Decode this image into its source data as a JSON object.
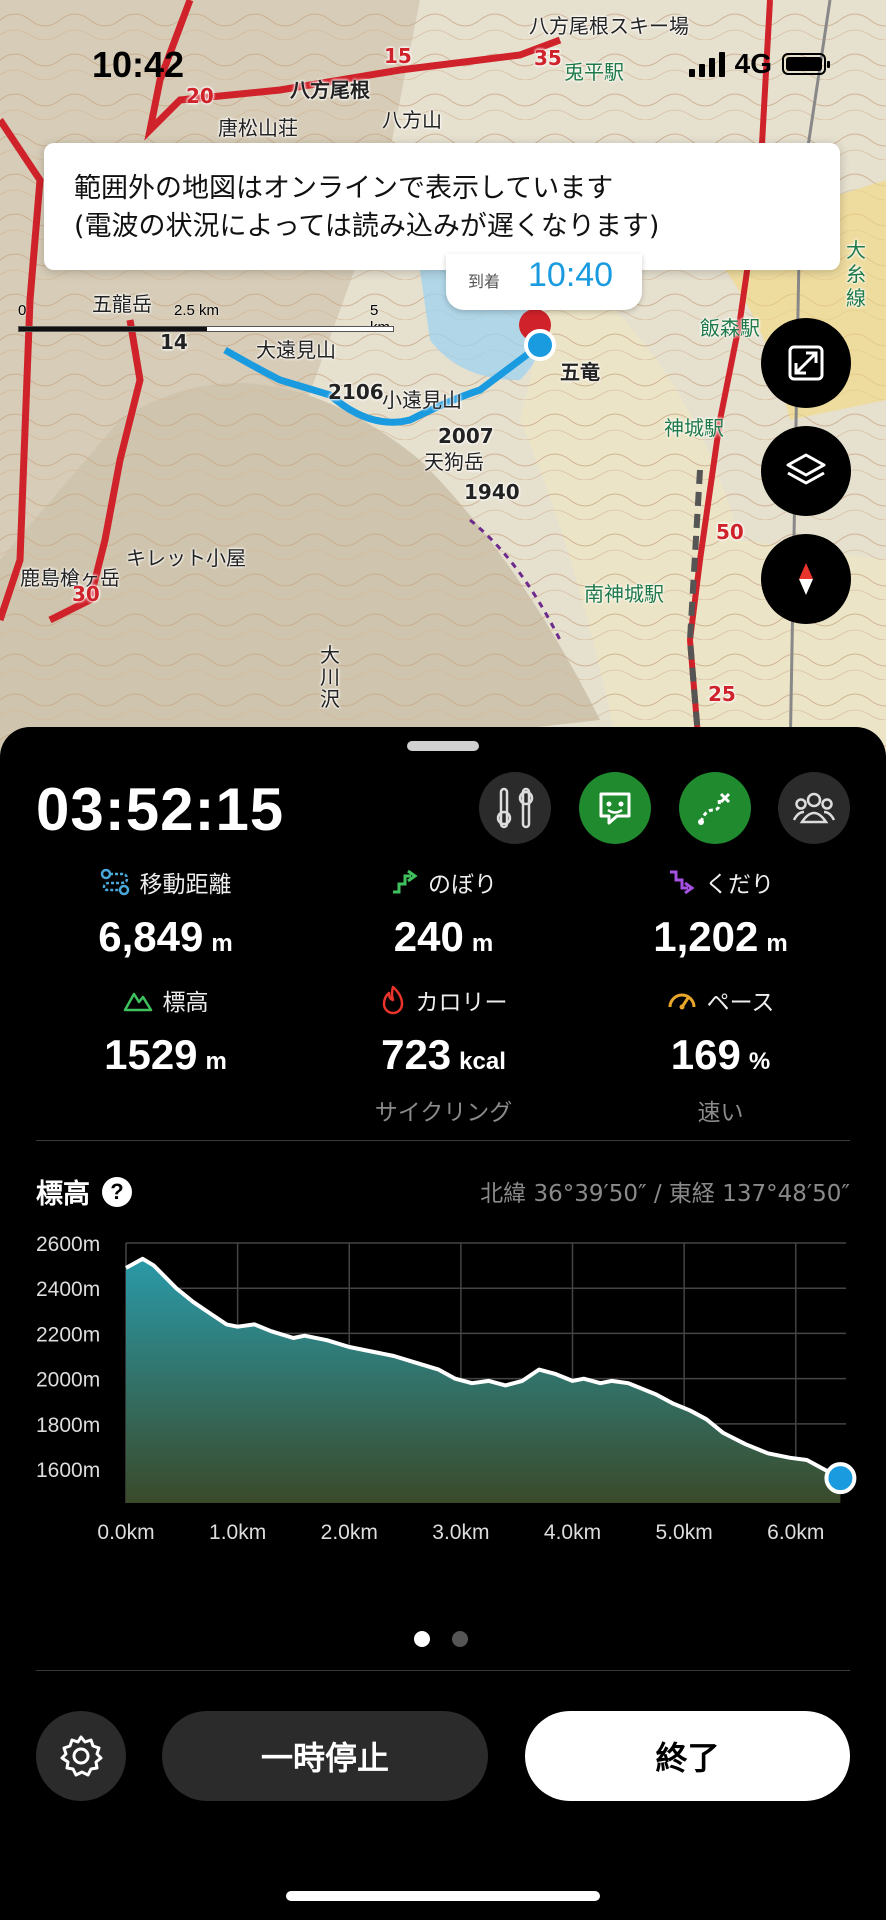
{
  "status_bar": {
    "time": "10:42",
    "network": "4G"
  },
  "map": {
    "notice_line1": "範囲外の地図はオンラインで表示しています",
    "notice_line2": "(電波の状況によっては読み込みが遅くなります)",
    "arrival_label": "到着",
    "arrival_time": "10:40",
    "scale_labels": [
      "0",
      "2.5 km",
      "5 km"
    ],
    "labels": {
      "happo_one": "八方尾根",
      "happo_ski": "八方尾根スキー場",
      "karamatsu_hut": "唐松山荘",
      "happosan": "八方山",
      "goryu": "五龍岳",
      "otomi": "大遠見山",
      "kotomi": "小遠見山",
      "tengu": "天狗岳",
      "elev_2007": "2007",
      "elev_1940": "1940",
      "elev_2106": "2106",
      "tsurugi_hut": "キレット小屋",
      "kashima": "鹿島槍ヶ岳",
      "okawa": "大川沢",
      "iimori": "飯森駅",
      "kamishiro": "神城駅",
      "minamikamishiro": "南神城駅",
      "goryu_ski": "五竜",
      "usagi_station": "兎平駅",
      "ojiro": "大糸線",
      "num_14": "14",
      "num_15": "15",
      "num_20": "20",
      "num_35": "35",
      "num_50": "50",
      "num_25": "25",
      "num_30": "30"
    }
  },
  "tracking": {
    "elapsed": "03:52:15",
    "stats": [
      {
        "label": "移動距離",
        "value": "6,849",
        "unit": "m",
        "sub": ""
      },
      {
        "label": "のぼり",
        "value": "240",
        "unit": "m",
        "sub": ""
      },
      {
        "label": "くだり",
        "value": "1,202",
        "unit": "m",
        "sub": ""
      },
      {
        "label": "標高",
        "value": "1529",
        "unit": "m",
        "sub": ""
      },
      {
        "label": "カロリー",
        "value": "723",
        "unit": "kcal",
        "sub": "サイクリング"
      },
      {
        "label": "ペース",
        "value": "169",
        "unit": "%",
        "sub": "速い"
      }
    ],
    "elevation_title": "標高",
    "help_label": "?",
    "coordinates": "北緯 36°39′50″ / 東経 137°48′50″",
    "buttons": {
      "pause": "一時停止",
      "end": "終了"
    }
  },
  "colors": {
    "accent_green": "#1f8a2e",
    "route_blue": "#1a9be0",
    "route_red": "#d0222a",
    "chart_fill_top": "#2a9aa8",
    "chart_fill_bottom": "#3a4a2a"
  },
  "chart_data": {
    "type": "area",
    "title": "標高",
    "x_unit": "km",
    "y_unit": "m",
    "xlim": [
      0,
      6.45
    ],
    "ylim": [
      1450,
      2600
    ],
    "x_ticks": [
      "0.0km",
      "1.0km",
      "2.0km",
      "3.0km",
      "4.0km",
      "5.0km",
      "6.0km"
    ],
    "y_ticks": [
      "2600m",
      "2400m",
      "2200m",
      "2000m",
      "1800m",
      "1600m"
    ],
    "x_tick_values": [
      0,
      1,
      2,
      3,
      4,
      5,
      6
    ],
    "y_tick_values": [
      2600,
      2400,
      2200,
      2000,
      1800,
      1600
    ],
    "series": [
      {
        "x": [
          0,
          0.15,
          0.25,
          0.45,
          0.6,
          0.75,
          0.9,
          1.0,
          1.15,
          1.3,
          1.5,
          1.6,
          1.8,
          2.0,
          2.2,
          2.4,
          2.6,
          2.8,
          2.95,
          3.1,
          3.25,
          3.4,
          3.55,
          3.7,
          3.85,
          4.0,
          4.1,
          4.25,
          4.35,
          4.5,
          4.6,
          4.75,
          4.9,
          5.05,
          5.2,
          5.35,
          5.55,
          5.75,
          5.95,
          6.1,
          6.25,
          6.4
        ],
        "y": [
          2490,
          2530,
          2500,
          2400,
          2340,
          2290,
          2240,
          2230,
          2240,
          2210,
          2180,
          2190,
          2170,
          2140,
          2120,
          2100,
          2070,
          2040,
          2000,
          1980,
          1990,
          1970,
          1990,
          2040,
          2020,
          1990,
          2000,
          1980,
          1990,
          1980,
          1960,
          1930,
          1890,
          1860,
          1820,
          1760,
          1710,
          1670,
          1650,
          1640,
          1600,
          1560
        ]
      }
    ],
    "current_point": {
      "x": 6.4,
      "y": 1560
    },
    "grid": true
  }
}
